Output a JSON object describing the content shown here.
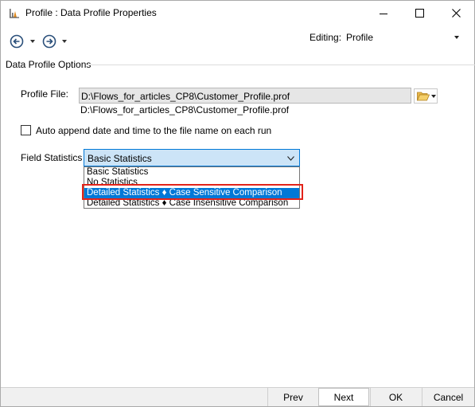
{
  "window": {
    "title": "Profile : Data Profile Properties"
  },
  "toolbar": {
    "editing_label": "Editing:",
    "editing_value": "Profile"
  },
  "group": {
    "title": "Data Profile Options"
  },
  "profile_file": {
    "label": "Profile File:",
    "value": "D:\\Flows_for_articles_CP8\\Customer_Profile.prof",
    "path_text": "D:\\Flows_for_articles_CP8\\Customer_Profile.prof"
  },
  "auto_append": {
    "label": "Auto append date and time to the file name on each run",
    "checked": false
  },
  "field_statistics": {
    "label": "Field Statistics :",
    "selected": "Basic Statistics",
    "options": [
      "Basic Statistics",
      "No Statistics",
      "Detailed Statistics ♦ Case Sensitive Comparison",
      "Detailed Statistics ♦ Case Insensitive Comparison"
    ],
    "highlighted_index": 2
  },
  "footer": {
    "prev": "Prev",
    "next": "Next",
    "ok": "OK",
    "cancel": "Cancel"
  },
  "colors": {
    "selection_blue": "#0078d7",
    "select_fill": "#cce4f7",
    "highlight_red": "#e2231a"
  }
}
